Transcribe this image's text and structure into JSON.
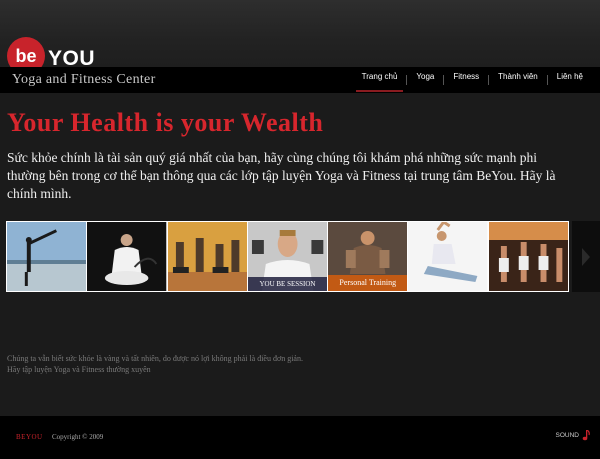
{
  "brand": {
    "logo_be": "be",
    "logo_you": "YOU",
    "tagline": "Yoga and Fitness Center"
  },
  "nav": {
    "items": [
      {
        "label": "Trang chủ",
        "active": true
      },
      {
        "label": "Yoga"
      },
      {
        "label": "Fitness"
      },
      {
        "label": "Thành viên"
      },
      {
        "label": "Liên hệ"
      }
    ]
  },
  "hero": {
    "headline": "Your Health is your Wealth",
    "intro": "Sức khỏe chính là tài sản quý giá nhất của bạn, hãy cùng chúng tôi khám phá những sức mạnh phi thường bên trong cơ thể bạn thông qua các lớp tập luyện Yoga và Fitness tại trung tâm BeYou. Hãy là chính mình."
  },
  "gallery": {
    "captions": {
      "t4": "YOU BE SESSION",
      "t5": "Personal Training"
    },
    "next_icon": "triangle-right-icon"
  },
  "note": {
    "line1": "Chúng ta vẫn biết sức khỏe là vàng và tất nhiên, do được nó lợi không phải là điều đơn giản.",
    "line2": "Hãy tập luyện Yoga và Fitness thường xuyên"
  },
  "footer": {
    "brand": "BEYOU",
    "copyright": "Copyright © 2009",
    "sound_label": "SOUND",
    "sound_icon": "music-note-icon"
  },
  "colors": {
    "accent": "#c8232b",
    "background": "#1b1b1b",
    "bar": "#000000"
  }
}
